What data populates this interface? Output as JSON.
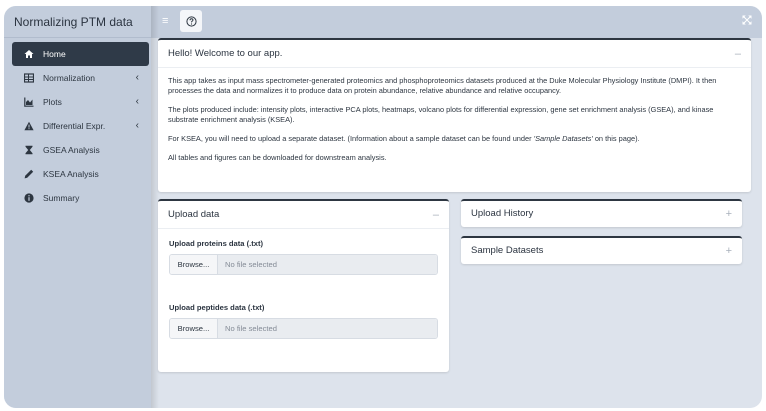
{
  "app": {
    "title": "Normalizing PTM data"
  },
  "sidebar": {
    "items": [
      {
        "label": "Home",
        "icon": "home-icon",
        "active": true,
        "has_children": false
      },
      {
        "label": "Normalization",
        "icon": "table-icon",
        "active": false,
        "has_children": true
      },
      {
        "label": "Plots",
        "icon": "area-chart-icon",
        "active": false,
        "has_children": true
      },
      {
        "label": "Differential Expr.",
        "icon": "warning-icon",
        "active": false,
        "has_children": true
      },
      {
        "label": "GSEA Analysis",
        "icon": "hourglass-icon",
        "active": false,
        "has_children": false
      },
      {
        "label": "KSEA Analysis",
        "icon": "pen-icon",
        "active": false,
        "has_children": false
      },
      {
        "label": "Summary",
        "icon": "info-icon",
        "active": false,
        "has_children": false
      }
    ],
    "chevron": "‹"
  },
  "topbar": {
    "hamburger": "≡"
  },
  "welcome": {
    "title": "Hello! Welcome to our app.",
    "collapse": "–",
    "p1": "This app takes as input mass spectrometer-generated proteomics and phosphoproteomics datasets produced at the Duke Molecular Physiology Institute (DMPI). It then processes the data and normalizes it to produce data on protein abundance, relative abundance and relative occupancy.",
    "p2": "The plots produced include: intensity plots, interactive PCA plots, heatmaps, volcano plots for differential expression, gene set enrichment analysis (GSEA), and kinase substrate enrichment analysis (KSEA).",
    "p3_pre": "For KSEA, you will need to upload a separate dataset. (Information about a sample dataset can be found under ",
    "p3_em": "'Sample Datasets'",
    "p3_post": " on this page).",
    "p4": "All tables and figures can be downloaded for downstream analysis."
  },
  "upload": {
    "title": "Upload data",
    "collapse": "–",
    "proteins_label": "Upload proteins data (.txt)",
    "peptides_label": "Upload peptides data (.txt)",
    "browse": "Browse...",
    "no_file": "No file selected"
  },
  "history": {
    "title": "Upload History",
    "expand": "+"
  },
  "samples": {
    "title": "Sample Datasets",
    "expand": "+"
  },
  "colors": {
    "sidebar_bg": "#c3cddc",
    "active_bg": "#2f3a48",
    "content_bg": "#dde3ec"
  }
}
